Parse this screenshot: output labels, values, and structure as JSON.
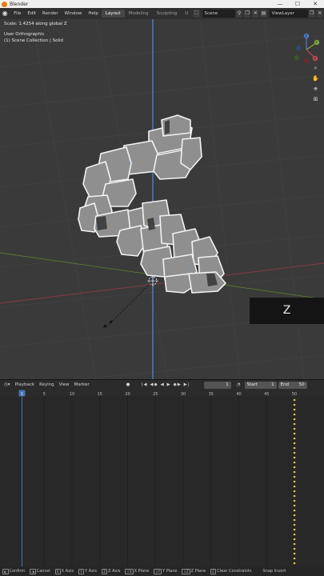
{
  "window": {
    "title": "Blender",
    "minimize": "—",
    "maximize": "☐",
    "close": "✕"
  },
  "menubar": {
    "menus": [
      "File",
      "Edit",
      "Render",
      "Window",
      "Help"
    ],
    "workspaces": [
      "Layout",
      "Modeling",
      "Sculpting",
      "U"
    ],
    "scene": "Scene",
    "view_layer": "ViewLayer"
  },
  "viewport": {
    "operator_text": "Scale: 1.4254 along global Z",
    "view_name": "User Orthographic",
    "collection_info": "(1) Scene Collection | Solid",
    "axis_overlay": "Z",
    "gizmo": {
      "x": "X",
      "y": "Y",
      "z": "Z"
    },
    "colors": {
      "x_axis": "#c24a55",
      "y_axis": "#7fa83c",
      "z_axis": "#4d7ecf"
    }
  },
  "timeline": {
    "menus": [
      "Playback",
      "Keying",
      "View",
      "Marker"
    ],
    "current_frame": "1",
    "start_label": "Start",
    "start_value": "1",
    "end_label": "End",
    "end_value": "50",
    "ruler_ticks": [
      "1",
      "5",
      "10",
      "15",
      "20",
      "25",
      "30",
      "35",
      "40",
      "45",
      "50"
    ],
    "playhead": "1"
  },
  "statusbar": {
    "items": [
      {
        "key": "◐",
        "label": "Confirm"
      },
      {
        "key": "◑",
        "label": "Cancel"
      },
      {
        "key": "X",
        "label": "X Axis"
      },
      {
        "key": "Y",
        "label": "Y Axis"
      },
      {
        "key": "Z",
        "label": "Z Axis"
      },
      {
        "key": "⇧X",
        "label": "X Plane"
      },
      {
        "key": "⇧Y",
        "label": "Y Plane"
      },
      {
        "key": "⇧Z",
        "label": "Z Plane"
      },
      {
        "key": "C",
        "label": "Clear Constraints"
      },
      {
        "key": "",
        "label": "Snap Invert"
      }
    ]
  }
}
